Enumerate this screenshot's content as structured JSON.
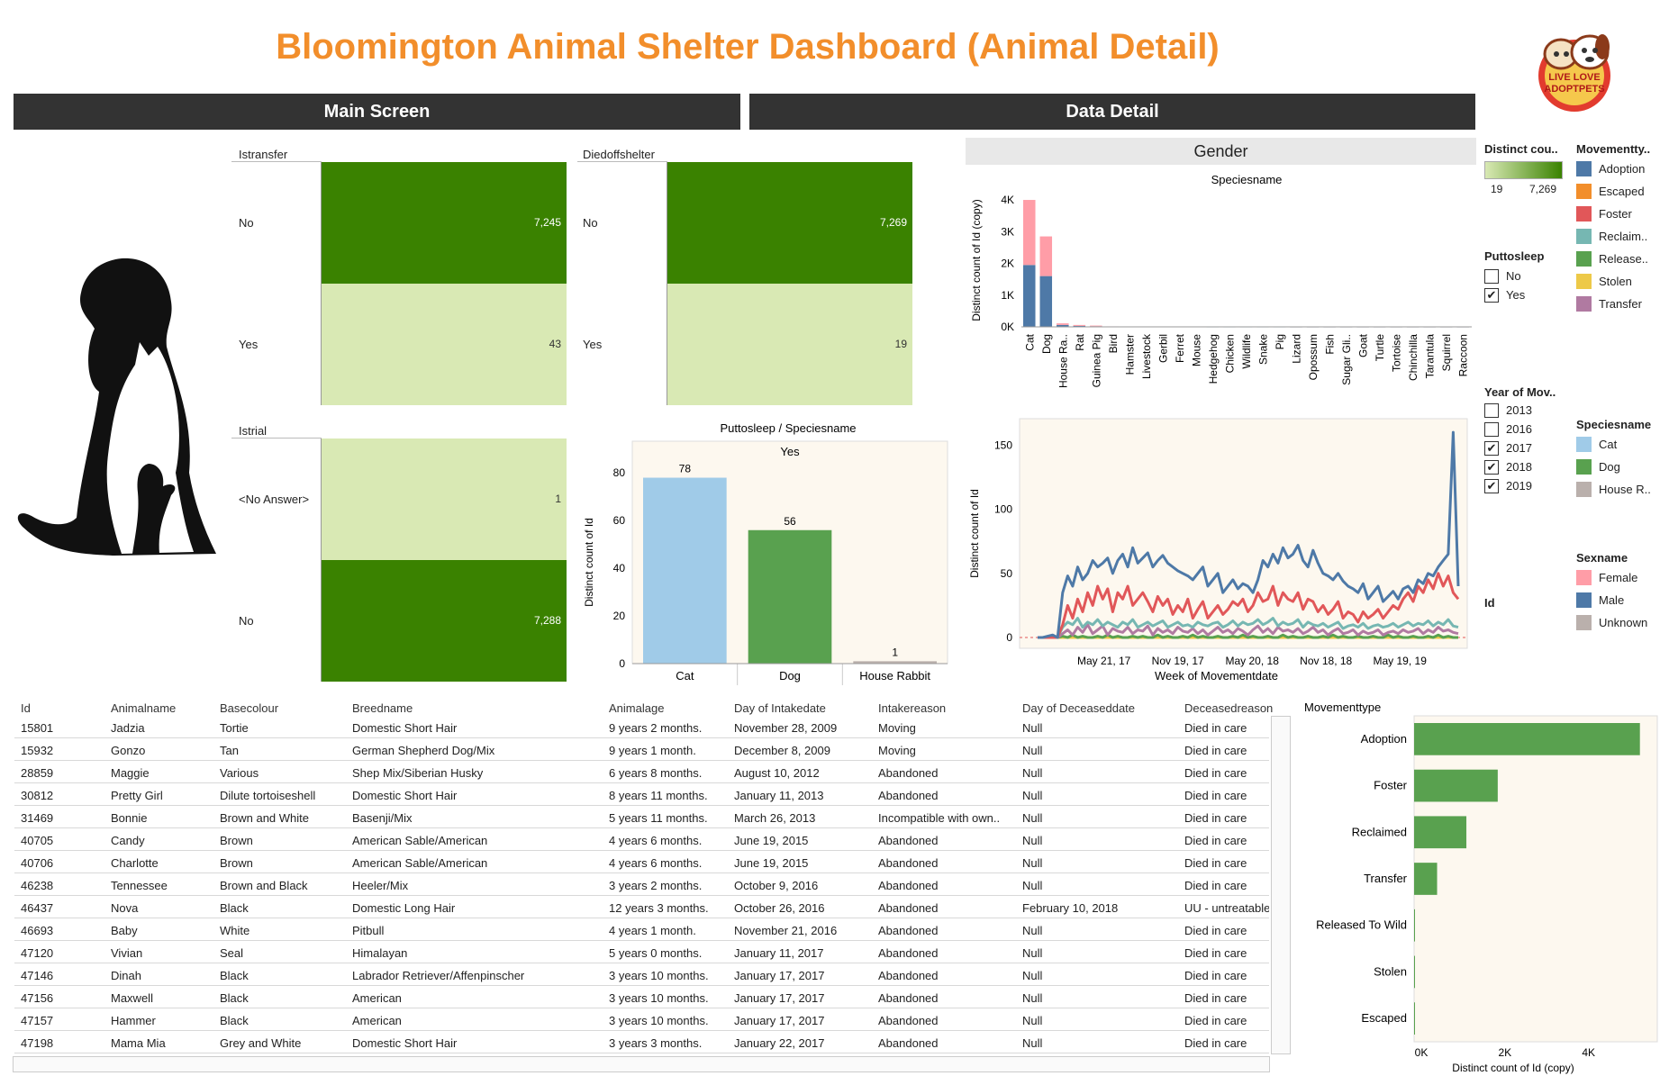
{
  "page": {
    "title": "Bloomington Animal Shelter Dashboard (Animal Detail)",
    "logo_text": "LIVE LOVE ADOPTPETS"
  },
  "banners": {
    "main": "Main Screen",
    "detail": "Data Detail"
  },
  "heatmaps": {
    "istransfer": {
      "title": "Istransfer",
      "rows": [
        {
          "label": "No",
          "value": "7,245",
          "color": "#3a8200"
        },
        {
          "label": "Yes",
          "value": "43",
          "color": "#d9e9b4"
        }
      ]
    },
    "diedoffshelter": {
      "title": "Diedoffshelter",
      "rows": [
        {
          "label": "No",
          "value": "7,269",
          "color": "#3a8200"
        },
        {
          "label": "Yes",
          "value": "19",
          "color": "#d9e9b4"
        }
      ]
    },
    "istrial": {
      "title": "Istrial",
      "rows": [
        {
          "label": "<No Answer>",
          "value": "1",
          "color": "#d9e9b4"
        },
        {
          "label": "No",
          "value": "7,288",
          "color": "#3a8200"
        }
      ]
    }
  },
  "legends": {
    "distinct_count": {
      "title": "Distinct cou..",
      "min": "19",
      "max": "7,269",
      "color_low": "#d9e9b4",
      "color_high": "#3a8200"
    },
    "movementtype": {
      "title": "Movementty..",
      "items": [
        {
          "label": "Adoption",
          "color": "#4e79a7"
        },
        {
          "label": "Escaped",
          "color": "#f28e2b"
        },
        {
          "label": "Foster",
          "color": "#e15759"
        },
        {
          "label": "Reclaim..",
          "color": "#76b7b2"
        },
        {
          "label": "Release..",
          "color": "#59a14f"
        },
        {
          "label": "Stolen",
          "color": "#edc948"
        },
        {
          "label": "Transfer",
          "color": "#b07aa1"
        }
      ]
    },
    "puttosleep": {
      "title": "Puttosleep",
      "items": [
        {
          "label": "No",
          "checked": false
        },
        {
          "label": "Yes",
          "checked": true
        }
      ]
    },
    "year": {
      "title": "Year of Mov..",
      "items": [
        {
          "label": "2013",
          "checked": false
        },
        {
          "label": "2016",
          "checked": false
        },
        {
          "label": "2017",
          "checked": true
        },
        {
          "label": "2018",
          "checked": true
        },
        {
          "label": "2019",
          "checked": true
        }
      ]
    },
    "speciesname": {
      "title": "Speciesname",
      "items": [
        {
          "label": "Cat",
          "color": "#a0cbe8"
        },
        {
          "label": "Dog",
          "color": "#59a14f"
        },
        {
          "label": "House R..",
          "color": "#bab0ac"
        }
      ]
    },
    "sexname": {
      "title": "Sexname",
      "items": [
        {
          "label": "Female",
          "color": "#ff9da7"
        },
        {
          "label": "Male",
          "color": "#4e79a7"
        },
        {
          "label": "Unknown",
          "color": "#bab0ac"
        }
      ]
    },
    "id_label": "Id"
  },
  "chart_data": [
    {
      "type": "bar",
      "id": "puttosleep-species",
      "title": "Puttosleep  /  Speciesname",
      "subtitle": "Yes",
      "ylabel": "Distinct count of Id",
      "categories": [
        "Cat",
        "Dog",
        "House Rabbit"
      ],
      "values": [
        78,
        56,
        1
      ],
      "colors": [
        "#a0cbe8",
        "#59a14f",
        "#bab0ac"
      ],
      "ylim": [
        0,
        85
      ],
      "yticks": [
        0,
        20,
        40,
        60,
        80
      ]
    },
    {
      "type": "bar",
      "id": "gender-species",
      "title": "Gender",
      "subtitle": "Speciesname",
      "ylabel": "Distinct count of Id (copy)",
      "categories": [
        "Cat",
        "Dog",
        "House Ra..",
        "Rat",
        "Guinea Pig",
        "Bird",
        "Hamster",
        "Livestock",
        "Gerbil",
        "Ferret",
        "Mouse",
        "Hedgehog",
        "Chicken",
        "Wildlife",
        "Snake",
        "Pig",
        "Lizard",
        "Opossum",
        "Fish",
        "Sugar Gli..",
        "Goat",
        "Turtle",
        "Tortoise",
        "Chinchilla",
        "Tarantula",
        "Squirrel",
        "Raccoon"
      ],
      "series": [
        {
          "name": "Male",
          "color": "#4e79a7",
          "values": [
            1950,
            1600,
            60,
            30,
            20,
            10,
            5,
            5,
            5,
            3,
            3,
            2,
            2,
            2,
            2,
            2,
            1,
            1,
            1,
            1,
            1,
            1,
            1,
            1,
            1,
            1,
            1
          ]
        },
        {
          "name": "Female",
          "color": "#ff9da7",
          "values": [
            2050,
            1250,
            50,
            30,
            20,
            5,
            5,
            5,
            3,
            3,
            2,
            2,
            2,
            1,
            1,
            1,
            1,
            1,
            1,
            1,
            1,
            1,
            1,
            1,
            1,
            1,
            1
          ]
        }
      ],
      "ylim": [
        0,
        4200
      ],
      "yticks": [
        "0K",
        "1K",
        "2K",
        "3K",
        "4K"
      ]
    },
    {
      "type": "line",
      "id": "weekly-movement",
      "xlabel": "Week of Movementdate",
      "ylabel": "Distinct count of Id",
      "xticks": [
        "May 21, 17",
        "Nov 19, 17",
        "May 20, 18",
        "Nov 18, 18",
        "May 19, 19"
      ],
      "ylim": [
        0,
        165
      ],
      "yticks": [
        0,
        50,
        100,
        150
      ],
      "series": [
        {
          "name": "Adoption",
          "color": "#4e79a7",
          "values": [
            0,
            0,
            1,
            2,
            0,
            35,
            48,
            40,
            55,
            45,
            50,
            60,
            55,
            58,
            62,
            50,
            60,
            65,
            55,
            70,
            58,
            62,
            66,
            55,
            60,
            64,
            58,
            55,
            52,
            50,
            48,
            45,
            50,
            55,
            40,
            45,
            50,
            35,
            40,
            45,
            38,
            42,
            40,
            35,
            45,
            60,
            55,
            65,
            58,
            70,
            62,
            65,
            72,
            60,
            55,
            68,
            58,
            50,
            48,
            45,
            50,
            44,
            40,
            38,
            35,
            42,
            30,
            35,
            40,
            28,
            32,
            36,
            30,
            38,
            40,
            35,
            45,
            42,
            50,
            48,
            55,
            60,
            65,
            160,
            40
          ]
        },
        {
          "name": "Foster",
          "color": "#e15759",
          "values": [
            0,
            0,
            0,
            0,
            0,
            10,
            25,
            15,
            30,
            20,
            35,
            25,
            40,
            30,
            38,
            20,
            35,
            30,
            40,
            25,
            30,
            35,
            28,
            20,
            32,
            25,
            30,
            18,
            25,
            20,
            30,
            15,
            22,
            28,
            15,
            20,
            25,
            18,
            22,
            28,
            25,
            30,
            20,
            25,
            35,
            28,
            30,
            40,
            25,
            35,
            30,
            28,
            35,
            22,
            30,
            28,
            20,
            25,
            18,
            22,
            28,
            15,
            20,
            18,
            12,
            20,
            15,
            18,
            22,
            15,
            20,
            25,
            22,
            30,
            35,
            28,
            40,
            35,
            45,
            38,
            50,
            40,
            48,
            35,
            30
          ]
        },
        {
          "name": "Reclaimed",
          "color": "#76b7b2",
          "values": [
            0,
            0,
            0,
            0,
            0,
            8,
            12,
            10,
            15,
            8,
            12,
            10,
            14,
            9,
            12,
            10,
            8,
            12,
            10,
            14,
            8,
            10,
            12,
            9,
            11,
            13,
            8,
            10,
            12,
            9,
            10,
            8,
            12,
            10,
            9,
            11,
            12,
            8,
            10,
            13,
            9,
            12,
            10,
            11,
            14,
            10,
            12,
            15,
            9,
            12,
            10,
            11,
            14,
            8,
            12,
            10,
            9,
            11,
            8,
            10,
            12,
            7,
            9,
            10,
            8,
            11,
            7,
            9,
            10,
            8,
            9,
            11,
            8,
            10,
            12,
            9,
            11,
            10,
            13,
            9,
            12,
            10,
            14,
            9,
            8
          ]
        },
        {
          "name": "Transfer",
          "color": "#b07aa1",
          "values": [
            0,
            0,
            0,
            0,
            0,
            3,
            6,
            2,
            8,
            4,
            10,
            3,
            6,
            9,
            2,
            7,
            5,
            4,
            8,
            3,
            6,
            5,
            9,
            2,
            7,
            4,
            6,
            3,
            8,
            5,
            4,
            7,
            3,
            6,
            2,
            5,
            8,
            4,
            6,
            3,
            7,
            5,
            2,
            6,
            9,
            4,
            7,
            3,
            8,
            5,
            6,
            4,
            7,
            3,
            5,
            8,
            4,
            6,
            2,
            5,
            7,
            3,
            4,
            6,
            2,
            5,
            3,
            4,
            6,
            2,
            4,
            5,
            3,
            6,
            4,
            5,
            7,
            3,
            6,
            4,
            8,
            5,
            6,
            4,
            3
          ]
        },
        {
          "name": "Release",
          "color": "#59a14f",
          "values": [
            0,
            0,
            0,
            0,
            0,
            1,
            0,
            2,
            0,
            1,
            0,
            0,
            1,
            0,
            2,
            0,
            1,
            0,
            0,
            1,
            0,
            1,
            0,
            0,
            2,
            0,
            1,
            0,
            0,
            1,
            0,
            2,
            0,
            1,
            0,
            0,
            1,
            0,
            0,
            1,
            0,
            2,
            0,
            1,
            0,
            0,
            1,
            0,
            0,
            2,
            0,
            1,
            0,
            0,
            1,
            0,
            0,
            1,
            0,
            2,
            0,
            1,
            0,
            0,
            1,
            0,
            0,
            1,
            0,
            0,
            2,
            0,
            1,
            0,
            0,
            1,
            0,
            0,
            1,
            0,
            2,
            0,
            1,
            0,
            0
          ]
        },
        {
          "name": "Stolen",
          "color": "#edc948",
          "values": [
            0,
            0,
            0,
            0,
            0,
            0,
            0,
            0,
            0,
            0,
            0,
            0,
            0,
            0,
            0,
            0,
            0,
            0,
            0,
            0,
            0,
            0,
            0,
            0,
            0,
            0,
            0,
            0,
            0,
            0,
            0,
            0,
            0,
            0,
            0,
            0,
            0,
            0,
            0,
            0,
            0,
            0,
            0,
            0,
            0,
            0,
            0,
            0,
            0,
            0,
            0,
            0,
            0,
            0,
            0,
            0,
            0,
            0,
            0,
            0,
            0,
            0,
            0,
            0,
            0,
            0,
            0,
            0,
            0,
            0,
            0,
            0,
            0,
            0,
            0,
            0,
            0,
            0,
            0,
            0,
            0,
            0,
            0,
            0,
            0
          ]
        }
      ]
    },
    {
      "type": "bar",
      "id": "movementtype",
      "title": "Movementtype",
      "xlabel": "Distinct count of Id (copy)",
      "categories": [
        "Adoption",
        "Foster",
        "Reclaimed",
        "Transfer",
        "Released To Wild",
        "Stolen",
        "Escaped"
      ],
      "values": [
        5400,
        2000,
        1250,
        550,
        10,
        5,
        5
      ],
      "color": "#59a14f",
      "xlim": [
        0,
        5600
      ],
      "xticks": [
        "0K",
        "2K",
        "4K"
      ]
    }
  ],
  "table": {
    "columns": [
      "Id",
      "Animalname",
      "Basecolour",
      "Breedname",
      "Animalage",
      "Day of Intakedate",
      "Intakereason",
      "Day of Deceaseddate",
      "Deceasedreason"
    ],
    "rows": [
      [
        "15801",
        "Jadzia",
        "Tortie",
        "Domestic Short Hair",
        "9 years 2 months.",
        "November 28, 2009",
        "Moving",
        "Null",
        "Died in care"
      ],
      [
        "15932",
        "Gonzo",
        "Tan",
        "German Shepherd Dog/Mix",
        "9 years 1 month.",
        "December 8, 2009",
        "Moving",
        "Null",
        "Died in care"
      ],
      [
        "28859",
        "Maggie",
        "Various",
        "Shep Mix/Siberian Husky",
        "6 years 8 months.",
        "August 10, 2012",
        "Abandoned",
        "Null",
        "Died in care"
      ],
      [
        "30812",
        "Pretty Girl",
        "Dilute tortoiseshell",
        "Domestic Short Hair",
        "8 years 11 months.",
        "January 11, 2013",
        "Abandoned",
        "Null",
        "Died in care"
      ],
      [
        "31469",
        "Bonnie",
        "Brown and White",
        "Basenji/Mix",
        "5 years 11 months.",
        "March 26, 2013",
        "Incompatible with own..",
        "Null",
        "Died in care"
      ],
      [
        "40705",
        "Candy",
        "Brown",
        "American Sable/American",
        "4 years 6 months.",
        "June 19, 2015",
        "Abandoned",
        "Null",
        "Died in care"
      ],
      [
        "40706",
        "Charlotte",
        "Brown",
        "American Sable/American",
        "4 years 6 months.",
        "June 19, 2015",
        "Abandoned",
        "Null",
        "Died in care"
      ],
      [
        "46238",
        "Tennessee",
        "Brown and Black",
        "Heeler/Mix",
        "3 years 2 months.",
        "October 9, 2016",
        "Abandoned",
        "Null",
        "Died in care"
      ],
      [
        "46437",
        "Nova",
        "Black",
        "Domestic Long Hair",
        "12 years 3 months.",
        "October 26, 2016",
        "Abandoned",
        "February 10, 2018",
        "UU - untreatable"
      ],
      [
        "46693",
        "Baby",
        "White",
        "Pitbull",
        "4 years 1 month.",
        "November 21, 2016",
        "Abandoned",
        "Null",
        "Died in care"
      ],
      [
        "47120",
        "Vivian",
        "Seal",
        "Himalayan",
        "5 years 0 months.",
        "January 11, 2017",
        "Abandoned",
        "Null",
        "Died in care"
      ],
      [
        "47146",
        "Dinah",
        "Black",
        "Labrador Retriever/Affenpinscher",
        "3 years 10 months.",
        "January 17, 2017",
        "Abandoned",
        "Null",
        "Died in care"
      ],
      [
        "47156",
        "Maxwell",
        "Black",
        "American",
        "3 years 10 months.",
        "January 17, 2017",
        "Abandoned",
        "Null",
        "Died in care"
      ],
      [
        "47157",
        "Hammer",
        "Black",
        "American",
        "3 years 10 months.",
        "January 17, 2017",
        "Abandoned",
        "Null",
        "Died in care"
      ],
      [
        "47198",
        "Mama Mia",
        "Grey and White",
        "Domestic Short Hair",
        "3 years 3 months.",
        "January 22, 2017",
        "Abandoned",
        "Null",
        "Died in care"
      ]
    ]
  }
}
